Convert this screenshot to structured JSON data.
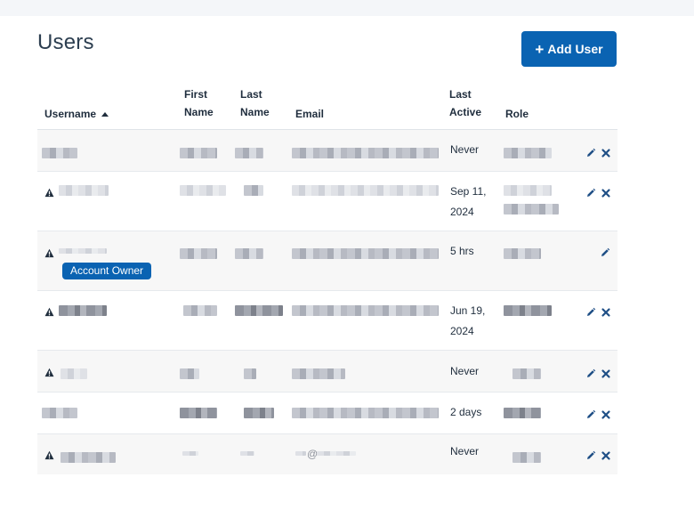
{
  "page": {
    "title": "Users",
    "add_button_label": "Add User"
  },
  "table": {
    "columns": {
      "username": "Username",
      "first_name_1": "First",
      "first_name_2": "Name",
      "last_name_1": "Last",
      "last_name_2": "Name",
      "email": "Email",
      "last_active_1": "Last",
      "last_active_2": "Active",
      "role": "Role"
    },
    "sort": {
      "column": "username",
      "direction": "ascending"
    },
    "badge_label": "Account Owner",
    "rows": [
      {
        "last_active_1": "Never",
        "last_active_2": ""
      },
      {
        "last_active_1": "Sep 11,",
        "last_active_2": "2024"
      },
      {
        "last_active_1": "5 hrs",
        "last_active_2": ""
      },
      {
        "last_active_1": "Jun 19,",
        "last_active_2": "2024"
      },
      {
        "last_active_1": "Never",
        "last_active_2": ""
      },
      {
        "last_active_1": "2 days",
        "last_active_2": ""
      },
      {
        "last_active_1": "Never",
        "last_active_2": "",
        "email_fragment": "@"
      }
    ]
  },
  "colors": {
    "accent": "#0a63b2",
    "text": "#1f2d3d",
    "row_alt": "#f7f7f7"
  },
  "icons": [
    "plus-icon",
    "sort-ascending-icon",
    "warning-icon",
    "edit-pencil-icon",
    "delete-x-icon"
  ]
}
